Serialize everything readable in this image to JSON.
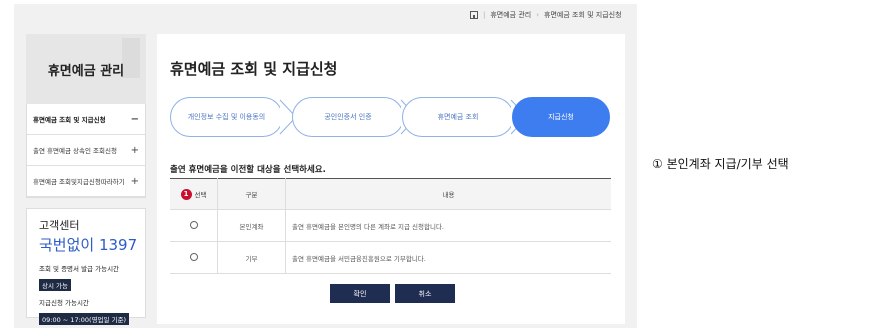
{
  "breadcrumb": {
    "items": [
      "휴면예금 관리",
      "휴면예금 조회 및 지급신청"
    ]
  },
  "sidebar": {
    "title": "휴면예금 관리",
    "items": [
      {
        "label": "휴면예금 조회 및 지급신청",
        "marker": "−"
      },
      {
        "label": "출연 휴면예금 상속인 조회신청",
        "marker": "+"
      },
      {
        "label": "휴면예금 조회및지급신청따라하기",
        "marker": "+"
      }
    ],
    "customer_center": {
      "title": "고객센터",
      "phone": "국번없이 1397",
      "hours1_label": "조회 및 증명서 발급 가능시간",
      "hours1_value": "상시 가능",
      "hours2_label": "지급신청 가능시간",
      "hours2_value": "09:00 ~ 17:00(영업일 기준)"
    }
  },
  "main": {
    "title": "휴면예금 조회 및 지급신청",
    "steps": [
      "개인정보 수집 및 이용동의",
      "공인인증서 인증",
      "휴면예금 조회",
      "지급신청"
    ],
    "section_title": "출연 휴면예금을 이전할 대상을 선택하세요.",
    "table": {
      "headers": [
        "선택",
        "구분",
        "내용"
      ],
      "rows": [
        {
          "type": "본인계좌",
          "content": "출연 휴면예금을 본인명의 다른 계좌로 지급 신청합니다."
        },
        {
          "type": "기부",
          "content": "출연 휴면예금을 서민금융진흥원으로 기부합니다."
        }
      ]
    },
    "buttons": {
      "confirm": "확인",
      "cancel": "취소"
    }
  },
  "annotation": {
    "badge": "1",
    "text": "① 본인계좌 지급/기부 선택"
  }
}
